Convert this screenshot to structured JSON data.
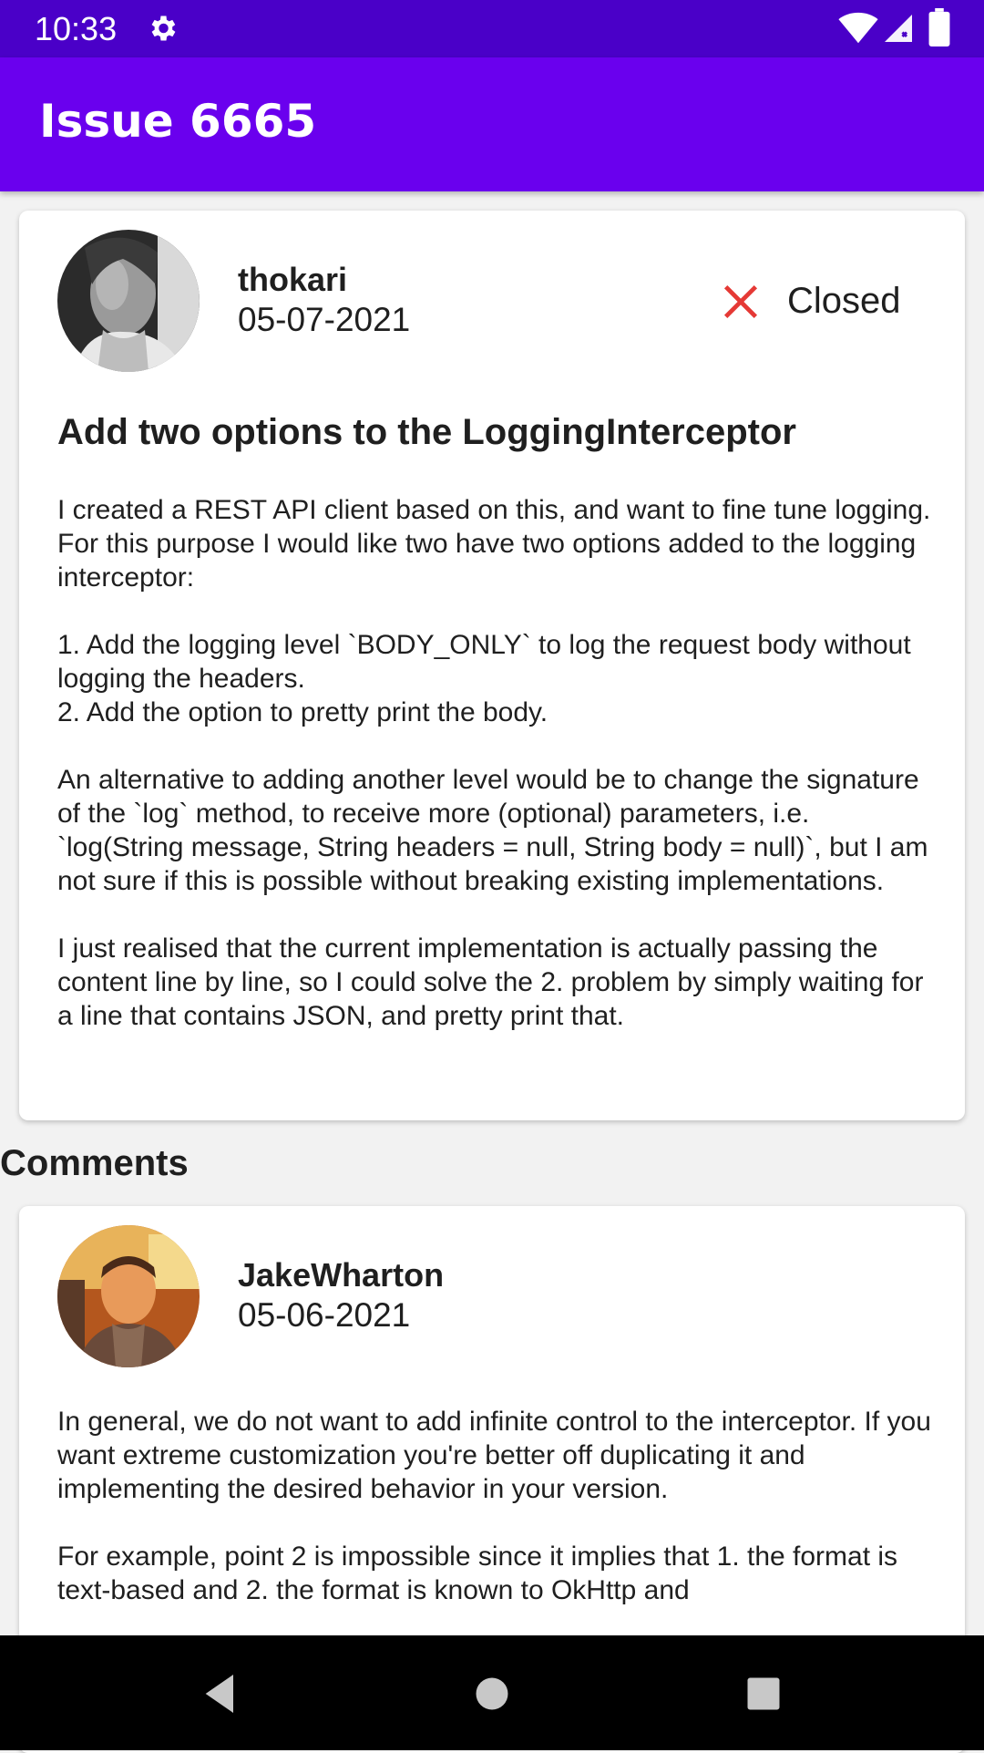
{
  "status_bar": {
    "time": "10:33",
    "icons": [
      "gear-icon",
      "wifi-icon",
      "signal-icon",
      "battery-icon"
    ]
  },
  "app_bar": {
    "title": "Issue 6665",
    "color": "#6a00ee"
  },
  "issue": {
    "author": "thokari",
    "date": "05-07-2021",
    "state": "Closed",
    "state_icon": "close-icon",
    "state_color": "#e53935",
    "title": "Add two options to the LoggingInterceptor",
    "body": "I created a REST API client based on this, and want to fine tune logging.\nFor this purpose I would like two have two options added to the logging interceptor:\n\n1. Add the logging level `BODY_ONLY` to log the request body without logging the headers.\n2. Add the option to pretty print the body.\n\nAn alternative to adding another level would be to change the signature of the `log` method, to receive more (optional) parameters, i.e. `log(String message, String headers = null, String body = null)`, but I am not sure if this is possible without breaking existing implementations.\n\nI just realised that the current implementation is actually passing the content line by line, so I could solve the 2. problem by simply waiting for a line that contains JSON, and pretty print that."
  },
  "comments_heading": "Comments",
  "comments": [
    {
      "author": "JakeWharton",
      "date": "05-06-2021",
      "body": "In general, we do not want to add infinite control to the interceptor. If you want extreme customization you're better off duplicating it and implementing the desired behavior in your version.\n\nFor example, point 2 is impossible since it implies that 1. the format is text-based and 2. the format is known to OkHttp and"
    }
  ],
  "nav_bar": {
    "icons": [
      "back-icon",
      "home-icon",
      "recents-icon"
    ]
  }
}
